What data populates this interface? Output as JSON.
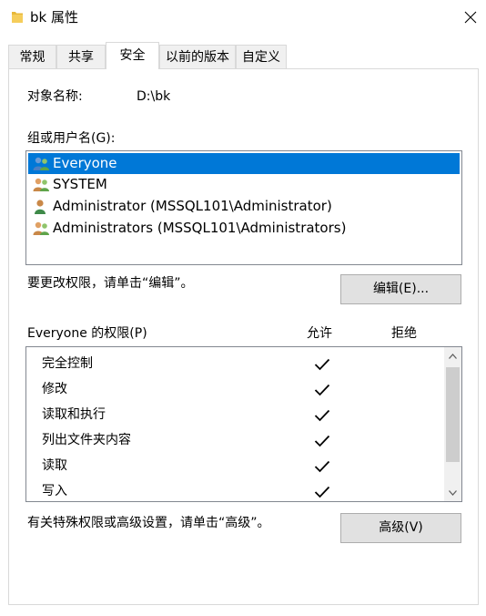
{
  "window": {
    "title": "bk 属性",
    "close_icon": "close-icon"
  },
  "tabs": [
    {
      "label": "常规",
      "active": false
    },
    {
      "label": "共享",
      "active": false
    },
    {
      "label": "安全",
      "active": true
    },
    {
      "label": "以前的版本",
      "active": false
    },
    {
      "label": "自定义",
      "active": false
    }
  ],
  "security": {
    "object_name_label": "对象名称:",
    "object_name_value": "D:\\bk",
    "groups_label": "组或用户名(G):",
    "users": [
      {
        "name": "Everyone",
        "icon": "user-group-icon",
        "selected": true
      },
      {
        "name": "SYSTEM",
        "icon": "user-group-icon",
        "selected": false
      },
      {
        "name": "Administrator (MSSQL101\\Administrator)",
        "icon": "user-icon",
        "selected": false
      },
      {
        "name": "Administrators (MSSQL101\\Administrators)",
        "icon": "user-group-icon",
        "selected": false
      }
    ],
    "edit_hint": "要更改权限，请单击“编辑”。",
    "edit_button": "编辑(E)...",
    "permissions_label": "Everyone 的权限(P)",
    "allow_header": "允许",
    "deny_header": "拒绝",
    "permissions": [
      {
        "name": "完全控制",
        "allow": true,
        "deny": false
      },
      {
        "name": "修改",
        "allow": true,
        "deny": false
      },
      {
        "name": "读取和执行",
        "allow": true,
        "deny": false
      },
      {
        "name": "列出文件夹内容",
        "allow": true,
        "deny": false
      },
      {
        "name": "读取",
        "allow": true,
        "deny": false
      },
      {
        "name": "写入",
        "allow": true,
        "deny": false
      }
    ],
    "advanced_hint": "有关特殊权限或高级设置，请单击“高级”。",
    "advanced_button": "高级(V)"
  },
  "colors": {
    "selection": "#0078d7",
    "folder": "#e8b83a"
  }
}
